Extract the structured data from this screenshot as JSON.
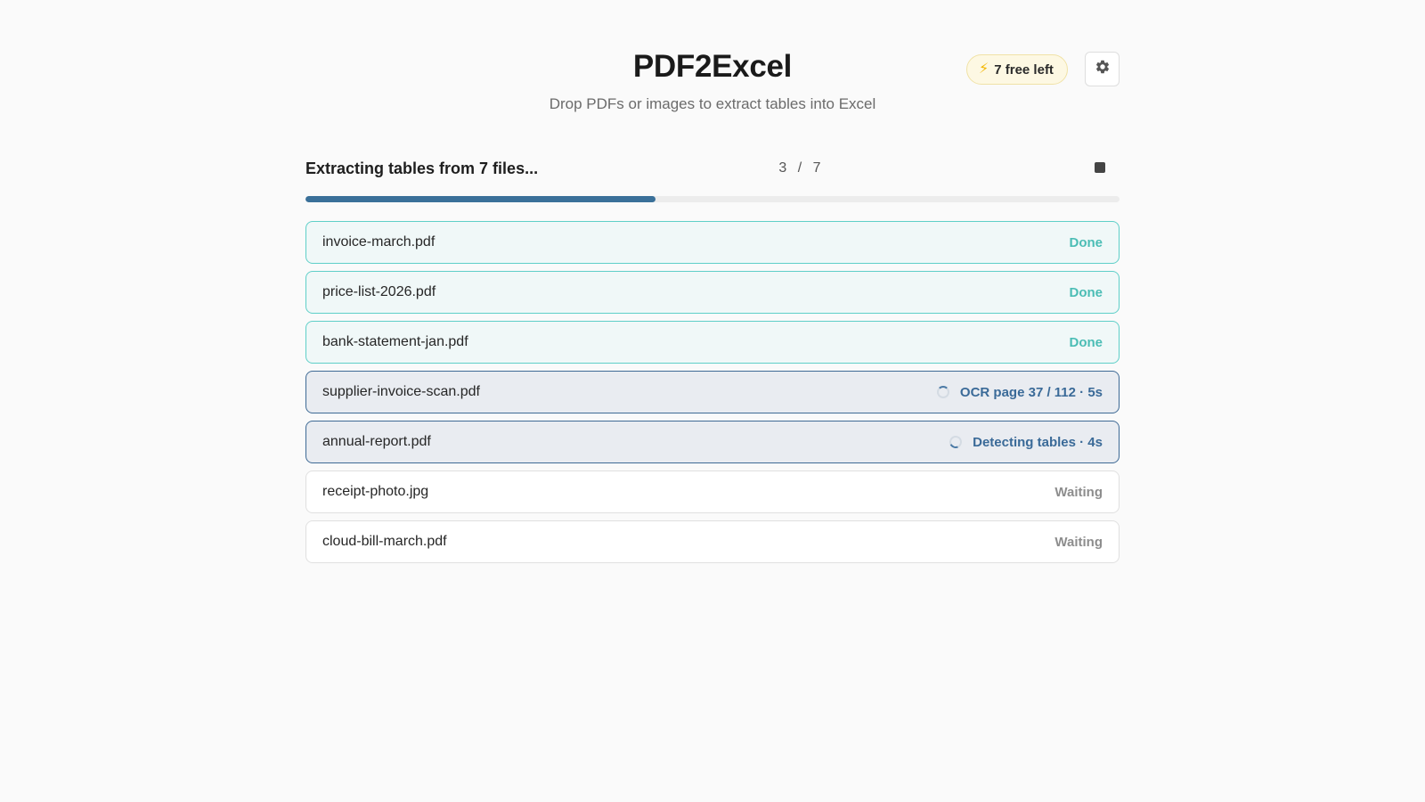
{
  "header": {
    "title": "PDF2Excel",
    "subtitle": "Drop PDFs or images to extract tables into Excel",
    "credits_label": "7 free left",
    "settings_icon": "gear-icon",
    "credits_icon": "bolt-icon"
  },
  "progress": {
    "label": "Extracting tables from 7 files...",
    "count": "3 / 7",
    "completed": 3,
    "total": 7,
    "fraction": 0.43,
    "stop_icon": "stop-icon",
    "color": "#3a7099"
  },
  "files": [
    {
      "name": "invoice-march.pdf",
      "state": "done",
      "status": "Done"
    },
    {
      "name": "price-list-2026.pdf",
      "state": "done",
      "status": "Done"
    },
    {
      "name": "bank-statement-jan.pdf",
      "state": "done",
      "status": "Done"
    },
    {
      "name": "supplier-invoice-scan.pdf",
      "state": "processing",
      "status": "OCR page 37 / 112 · 5s"
    },
    {
      "name": "annual-report.pdf",
      "state": "processing",
      "status": "Detecting tables · 4s"
    },
    {
      "name": "receipt-photo.jpg",
      "state": "waiting",
      "status": "Waiting"
    },
    {
      "name": "cloud-bill-march.pdf",
      "state": "waiting",
      "status": "Waiting"
    }
  ],
  "colors": {
    "done": "#4bbdb5",
    "processing": "#3a6a98",
    "waiting": "#8d8d8d",
    "accent": "#3a7099"
  }
}
